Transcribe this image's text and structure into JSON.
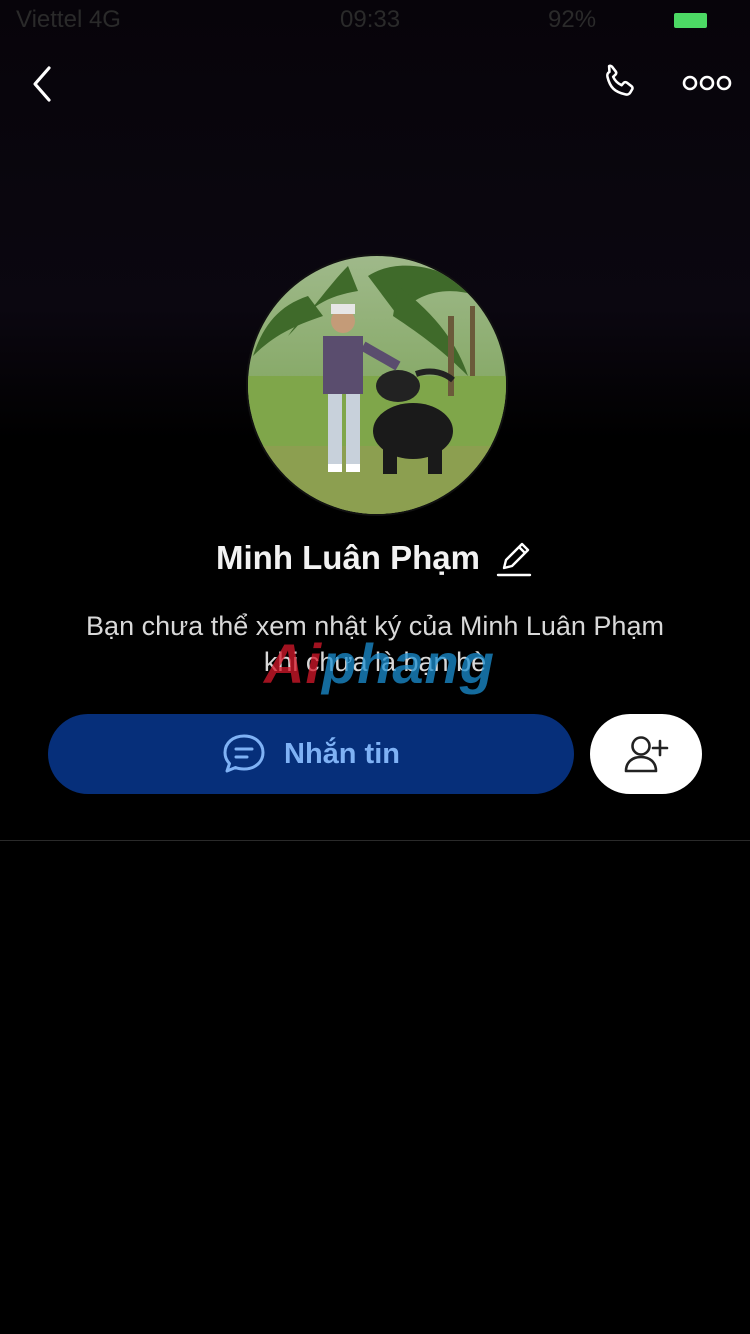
{
  "status_bar": {
    "carrier": "Viettel 4G",
    "time": "09:33",
    "battery_text": "92%"
  },
  "colors": {
    "background": "#000000",
    "message_button_bg": "#062f7a",
    "message_button_text": "#7fb2f5",
    "battery": "#4cd964"
  },
  "header": {
    "back_icon": "chevron-left-icon",
    "call_icon": "phone-icon",
    "more_icon": "more-dots-icon"
  },
  "profile": {
    "name": "Minh Luân Phạm",
    "edit_icon": "pencil-icon",
    "notice_line1": "Bạn chưa thể xem nhật ký của Minh Luân Phạm",
    "notice_line2": "khi chưa là bạn bè"
  },
  "watermark": {
    "part1": "Ai",
    "part2": "phang"
  },
  "actions": {
    "message_label": "Nhắn tin",
    "message_icon": "chat-bubble-icon",
    "add_friend_icon": "add-user-icon"
  }
}
